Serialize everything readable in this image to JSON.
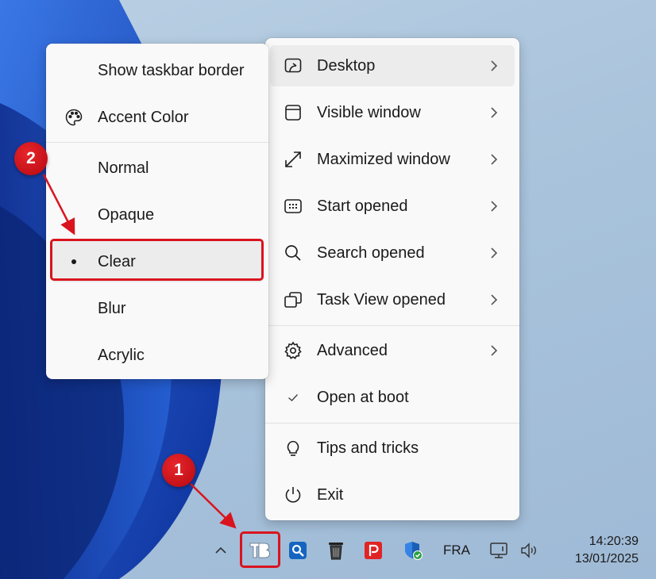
{
  "main_menu": {
    "items": [
      {
        "label": "Desktop",
        "icon": "desktop-icon",
        "submenu": true
      },
      {
        "label": "Visible window",
        "icon": "window-icon",
        "submenu": true
      },
      {
        "label": "Maximized window",
        "icon": "maximize-icon",
        "submenu": true
      },
      {
        "label": "Start opened",
        "icon": "start-icon",
        "submenu": true
      },
      {
        "label": "Search opened",
        "icon": "search-icon",
        "submenu": true
      },
      {
        "label": "Task View opened",
        "icon": "task-view-icon",
        "submenu": true
      },
      {
        "label": "Advanced",
        "icon": "gear-icon",
        "submenu": true
      },
      {
        "label": "Open at boot",
        "icon": "checkmark-icon",
        "checked": true
      },
      {
        "label": "Tips and tricks",
        "icon": "lightbulb-icon"
      },
      {
        "label": "Exit",
        "icon": "power-icon"
      }
    ]
  },
  "sub_menu": {
    "items": [
      {
        "label": "Show taskbar border"
      },
      {
        "label": "Accent Color",
        "icon": "palette-icon"
      },
      {
        "label": "Normal"
      },
      {
        "label": "Opaque"
      },
      {
        "label": "Clear",
        "selected": true
      },
      {
        "label": "Blur"
      },
      {
        "label": "Acrylic"
      }
    ]
  },
  "annotations": {
    "step1": "1",
    "step2": "2",
    "color": "#d9141e"
  },
  "taskbar": {
    "language": "FRA",
    "time": "14:20:39",
    "date": "13/01/2025"
  },
  "colors": {
    "menu_bg": "#f9f9f9",
    "hover_bg": "#ececec",
    "wallpaper_blue": "#1d4fc4"
  }
}
